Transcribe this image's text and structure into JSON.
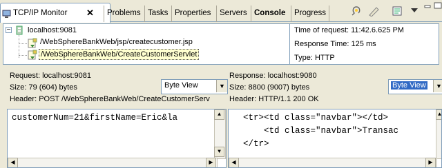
{
  "tabs": [
    {
      "label": "TCP/IP Monitor",
      "active": true,
      "close": "✕"
    },
    {
      "label": "Problems"
    },
    {
      "label": "Tasks"
    },
    {
      "label": "Properties"
    },
    {
      "label": "Servers"
    },
    {
      "label": "Console",
      "bold": true
    },
    {
      "label": "Progress"
    }
  ],
  "tree": {
    "host": "localhost:9081",
    "expand_glyph": "−",
    "requests": [
      "/WebSphereBankWeb/jsp/createcustomer.jsp",
      "/WebSphereBankWeb/CreateCustomerServlet"
    ]
  },
  "request_info": {
    "time": "Time of request: 11:42.6.625 PM",
    "response_time": "Response Time: 125 ms",
    "type": "Type: HTTP"
  },
  "request": {
    "label": "Request: localhost:9081",
    "size": "Size: 79 (604) bytes",
    "header": "Header: POST /WebSphereBankWeb/CreateCustomerServ",
    "view": "Byte View",
    "body": "customerNum=21&firstName=Eric&la"
  },
  "response": {
    "label": "Response: localhost:9080",
    "size": "Size: 8800 (9007) bytes",
    "header": "Header: HTTP/1.1 200 OK",
    "view": "Byte View",
    "body_lines": [
      "  <tr><td class=\"navbar\"></td>",
      "      <td class=\"navbar\">Transac",
      "  </tr>"
    ]
  },
  "colors": {
    "panel": "#ece9d8",
    "border": "#7f9db9",
    "selection": "#ffffd0",
    "combo_highlight": "#316ac5"
  },
  "icons": {
    "monitor": "monitor-icon",
    "tree_toggle": "collapse-icon",
    "server": "server-icon",
    "request": "request-icon"
  }
}
